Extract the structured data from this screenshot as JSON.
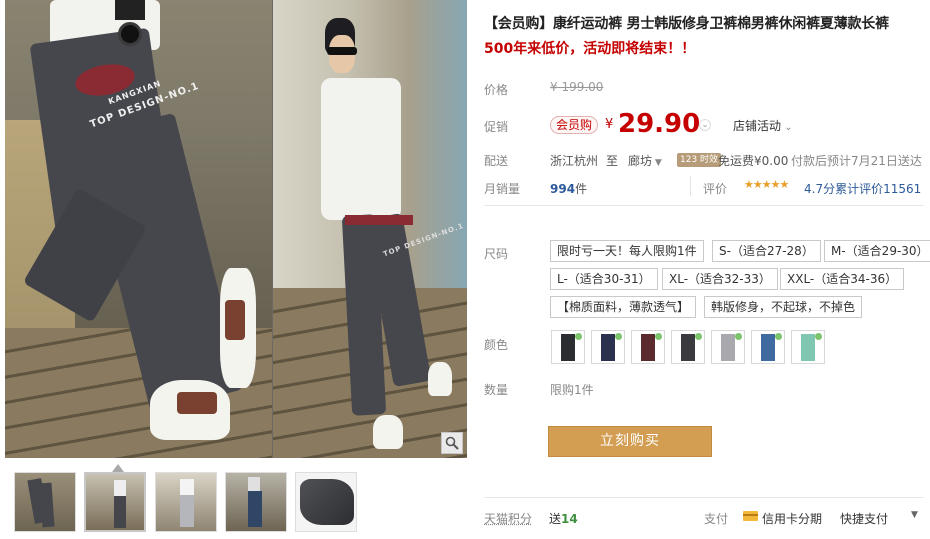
{
  "product": {
    "title": "【会员购】康纤运动裤 男士韩版修身卫裤棉男裤休闲裤夏薄款长裤",
    "subtitle": "500年来低价，活动即将结束！！"
  },
  "price": {
    "label": "价格",
    "original": "¥ 199.00",
    "promo_label": "促销",
    "member_badge": "会员购",
    "currency": "¥",
    "current": "29.90",
    "store_promo": "店铺活动"
  },
  "delivery": {
    "label": "配送",
    "from": "浙江杭州",
    "to_word": "至",
    "to": "廊坊",
    "badge": "123 时效",
    "shipping": "免运费¥0.00",
    "eta": "付款后预计7月21日送达"
  },
  "sales": {
    "label": "月销量",
    "count": "994",
    "unit": "件",
    "review_label": "评价",
    "stars": "★★★★★",
    "score": "4.7分",
    "review_count": "累计评价11561"
  },
  "size": {
    "label": "尺码",
    "options": [
      "限时亏一天！每人限购1件",
      "S-（适合27-28）",
      "M-（适合29-30）",
      "L-（适合30-31）",
      "XL-（适合32-33）",
      "XXL-（适合34-36）",
      "【棉质面料，薄款透气】",
      "韩版修身，不起球，不掉色"
    ]
  },
  "color": {
    "label": "颜色",
    "swatches": [
      "#2b2d33",
      "#2c3150",
      "#5a2a2e",
      "#3a3a40",
      "#a9a9ad",
      "#3f6ba1",
      "#7fc7b1"
    ]
  },
  "quantity": {
    "label": "数量",
    "limit": "限购1件"
  },
  "buy_button": "立刻购买",
  "footer": {
    "points_label": "天猫积分",
    "points_prefix": "送",
    "points_value": "14",
    "pay_label": "支付",
    "card_installment": "信用卡分期",
    "quick_pay": "快捷支付"
  },
  "photo_text": {
    "print_1": "KANGXIAN",
    "print_2": "TOP DESIGN-NO.1",
    "print_3": "TOP DESIGN-NO.1"
  }
}
